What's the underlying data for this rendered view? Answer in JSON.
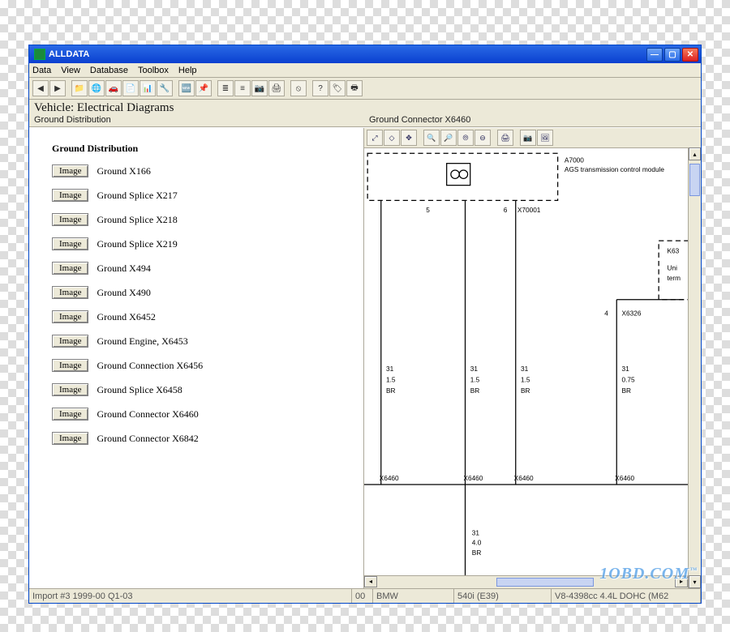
{
  "title": "ALLDATA",
  "menu": [
    "Data",
    "View",
    "Database",
    "Toolbox",
    "Help"
  ],
  "vehicle_line": "Vehicle:  Electrical Diagrams",
  "left_subtitle": "Ground Distribution",
  "right_subtitle": "Ground Connector X6460",
  "list_heading": "Ground Distribution",
  "image_btn_label": "Image",
  "items": [
    "Ground X166",
    "Ground Splice X217",
    "Ground Splice X218",
    "Ground Splice X219",
    "Ground X494",
    "Ground X490",
    "Ground X6452",
    "Ground Engine, X6453",
    "Ground Connection X6456",
    "Ground Splice X6458",
    "Ground Connector X6460",
    "Ground Connector X6842"
  ],
  "diagram": {
    "module_box": {
      "id": "A7000",
      "desc": "AGS transmission control module"
    },
    "side_box": {
      "id": "K63",
      "l1": "Uni",
      "l2": "term"
    },
    "top_pins": {
      "p5": "5",
      "p6": "6",
      "conn": "X70001"
    },
    "x6326": {
      "pin": "4",
      "conn": "X6326"
    },
    "wires": [
      {
        "pin": "31",
        "size": "1.5",
        "color": "BR",
        "bottom": "X6460"
      },
      {
        "pin": "31",
        "size": "1.5",
        "color": "BR",
        "bottom": "X6460"
      },
      {
        "pin": "31",
        "size": "1.5",
        "color": "BR",
        "bottom": "X6460"
      },
      {
        "pin": "31",
        "size": "0.75",
        "color": "BR",
        "bottom": "X6460"
      }
    ],
    "tail": {
      "pin": "31",
      "size": "4.0",
      "color": "BR"
    }
  },
  "status": {
    "c1": "Import #3 1999-00 Q1-03",
    "c2": "00",
    "c3": "BMW",
    "c4": "540i (E39)",
    "c5": "V8-4398cc 4.4L DOHC (M62"
  },
  "watermark": "1OBD.COM"
}
